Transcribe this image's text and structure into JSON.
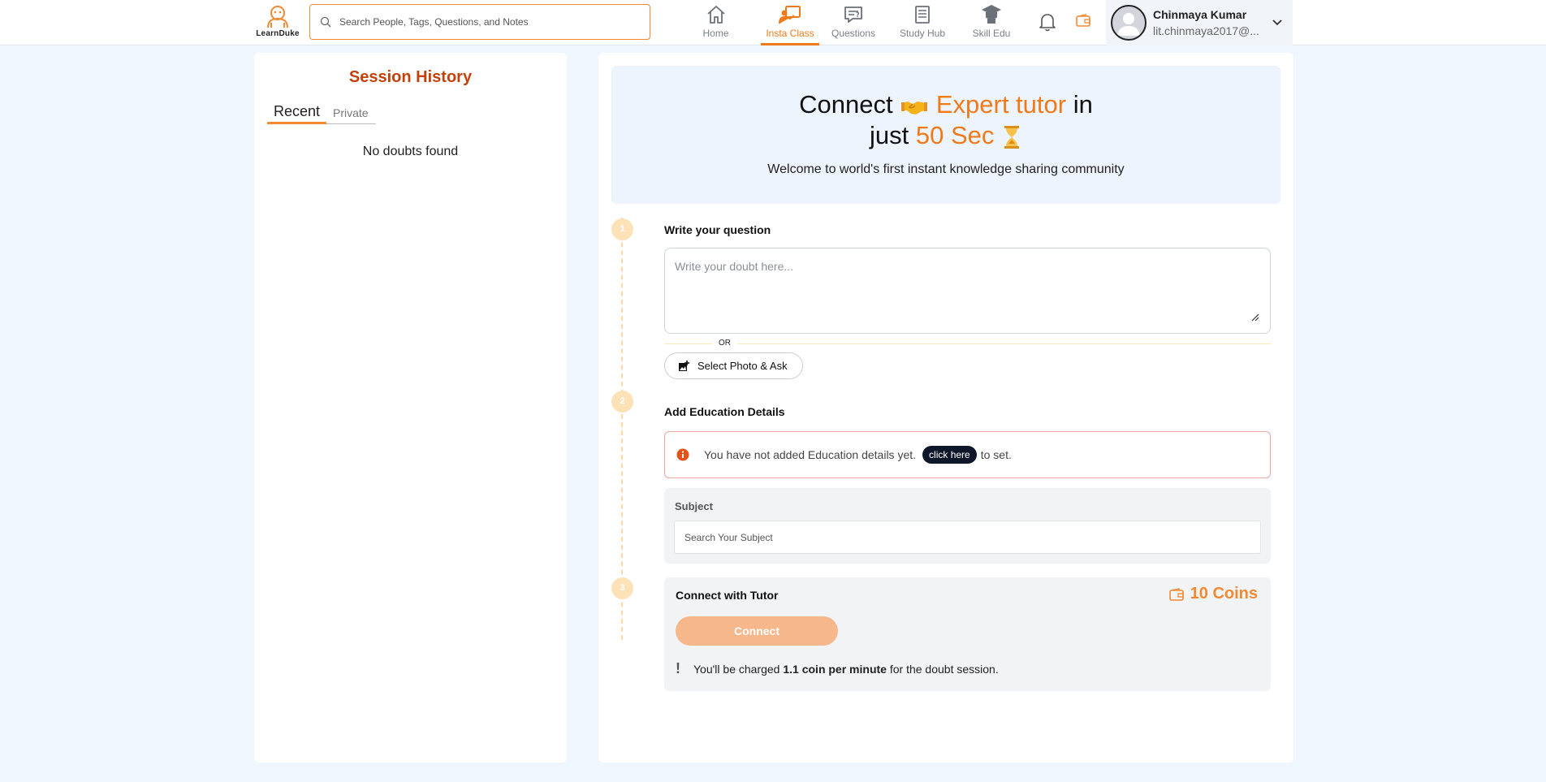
{
  "header": {
    "logo_text": "LearnDuke",
    "search_placeholder": "Search People, Tags, Questions, and Notes",
    "nav": [
      {
        "label": "Home",
        "icon": "home-icon"
      },
      {
        "label": "Insta Class",
        "icon": "insta-class-icon",
        "active": true
      },
      {
        "label": "Questions",
        "icon": "questions-icon"
      },
      {
        "label": "Study Hub",
        "icon": "study-hub-icon"
      },
      {
        "label": "Skill Edu",
        "icon": "graduation-cap-icon"
      }
    ],
    "user": {
      "name": "Chinmaya Kumar",
      "email": "lit.chinmaya2017@..."
    }
  },
  "sidebar": {
    "title": "Session History",
    "tabs": [
      "Recent",
      "Private"
    ],
    "empty_text": "No doubts found"
  },
  "hero": {
    "connect": "Connect",
    "expert_tutor": "Expert tutor",
    "in": "in",
    "just": "just",
    "sec": "50 Sec",
    "subtitle": "Welcome to world's first instant knowledge sharing community"
  },
  "steps": {
    "one": {
      "num": "1",
      "title": "Write your question",
      "placeholder": "Write your doubt here...",
      "or": "OR",
      "photo_button": "Select Photo & Ask"
    },
    "two": {
      "num": "2",
      "title": "Add Education Details",
      "alert_text": "You have not added Education details yet.",
      "click_here": "click here",
      "alert_suffix": "to set.",
      "subject_label": "Subject",
      "subject_placeholder": "Search Your Subject"
    },
    "three": {
      "num": "3",
      "title": "Connect with Tutor",
      "coins": "10 Coins",
      "connect_button": "Connect",
      "charge_prefix": "You'll be charged",
      "charge_bold": "1.1 coin per minute",
      "charge_suffix": "for the doubt session."
    }
  },
  "colors": {
    "accent": "#f07a1a",
    "title": "#c2410c",
    "background": "#f0f6fd"
  }
}
